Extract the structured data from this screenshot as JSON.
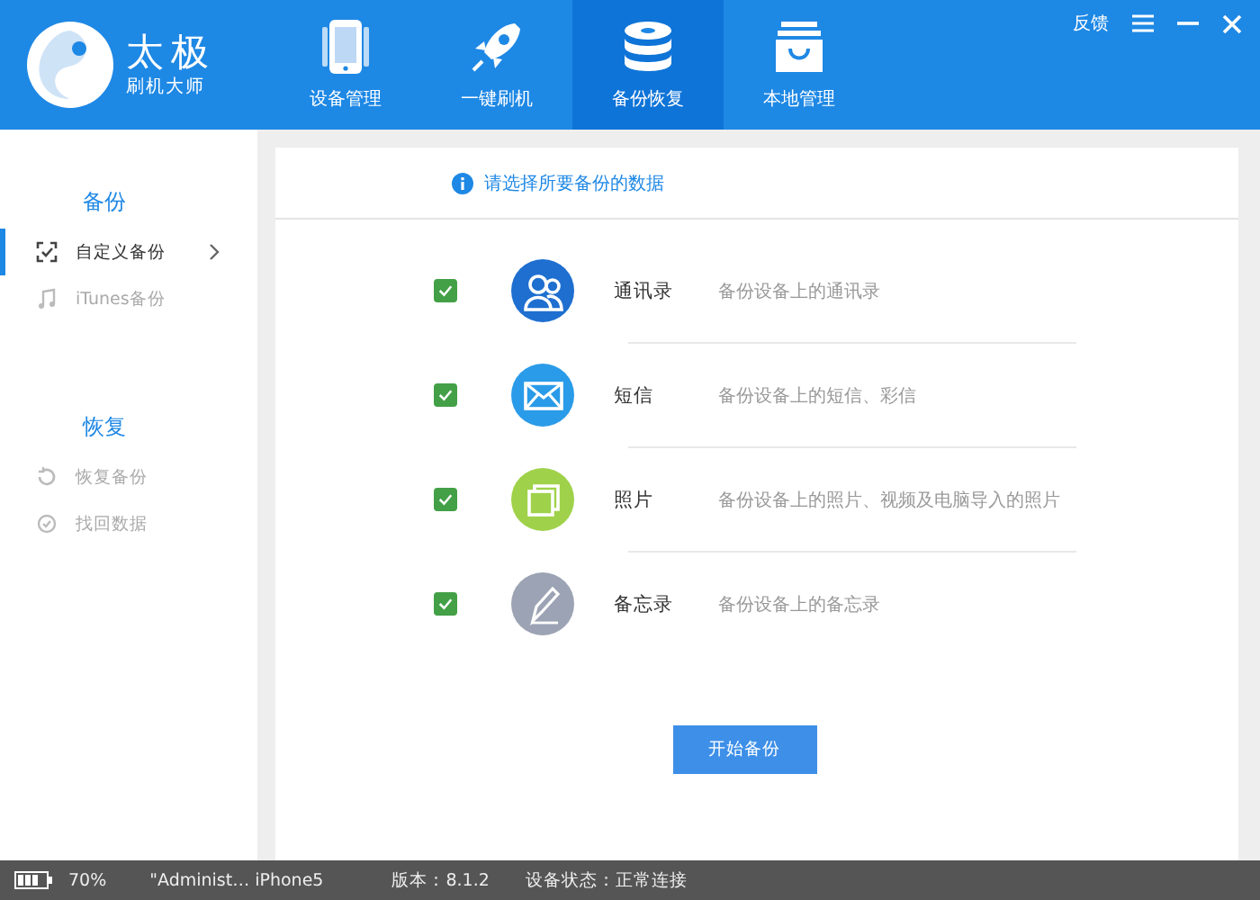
{
  "app": {
    "name": "太极",
    "subtitle": "刷机大师"
  },
  "nav_tabs": [
    {
      "label": "设备管理",
      "kind": "phone",
      "selected": false
    },
    {
      "label": "一键刷机",
      "kind": "rocket",
      "selected": false
    },
    {
      "label": "备份恢复",
      "kind": "disk",
      "selected": true
    },
    {
      "label": "本地管理",
      "kind": "box",
      "selected": false
    }
  ],
  "feedback": "反馈",
  "sidebar": [
    {
      "title": "备份",
      "items": [
        {
          "label": "自定义备份",
          "kind": "check",
          "selected": true
        },
        {
          "label": "iTunes备份",
          "kind": "music",
          "selected": false
        }
      ]
    },
    {
      "title": "恢复",
      "items": [
        {
          "label": "恢复备份",
          "kind": "restore",
          "selected": false
        },
        {
          "label": "找回数据",
          "kind": "find",
          "selected": false
        }
      ]
    }
  ],
  "hint": "请选择所要备份的数据",
  "data_items": [
    {
      "name": "通讯录",
      "description": "备份设备上的通讯录",
      "kind": "contacts",
      "color": "#1e6fd0",
      "checked": true
    },
    {
      "name": "短信",
      "description": "备份设备上的短信、彩信",
      "kind": "mail",
      "color": "#2a9be8",
      "checked": true
    },
    {
      "name": "照片",
      "description": "备份设备上的照片、视频及电脑导入的照片",
      "kind": "photos",
      "color": "#9fd24a",
      "checked": true
    },
    {
      "name": "备忘录",
      "description": "备份设备上的备忘录",
      "kind": "notes",
      "color": "#9ca3b4",
      "checked": true
    }
  ],
  "start_button": "开始备份",
  "status_bar": {
    "battery": "70%",
    "device": "\"Administ… iPhone5",
    "version": "版本：8.1.2",
    "state": "设备状态：正常连接"
  }
}
